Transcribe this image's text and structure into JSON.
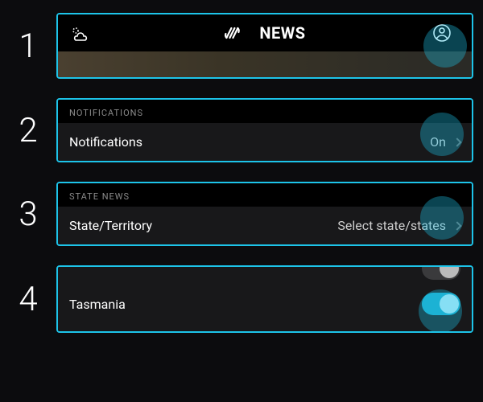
{
  "steps": {
    "s1": {
      "num": "1",
      "brand": "NEWS"
    },
    "s2": {
      "num": "2",
      "section": "NOTIFICATIONS",
      "label": "Notifications",
      "value": "On"
    },
    "s3": {
      "num": "3",
      "section": "STATE NEWS",
      "label": "State/Territory",
      "value": "Select state/states"
    },
    "s4": {
      "num": "4",
      "item": "Tasmania"
    }
  }
}
